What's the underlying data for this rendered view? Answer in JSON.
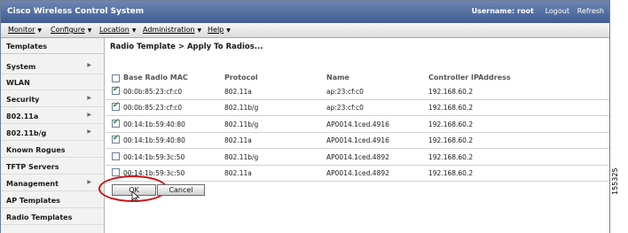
{
  "app": {
    "title": "Cisco Wireless Control System",
    "user_text": "Username: root",
    "logout": "Logout",
    "refresh": "Refresh"
  },
  "menu": [
    {
      "label": "Monitor"
    },
    {
      "label": "Configure"
    },
    {
      "label": "Location"
    },
    {
      "label": "Administration"
    },
    {
      "label": "Help"
    }
  ],
  "sidebar": {
    "header": "Templates",
    "items": [
      {
        "label": "System",
        "arrow": "▶"
      },
      {
        "label": "WLAN",
        "arrow": ""
      },
      {
        "label": "Security",
        "arrow": "▶"
      },
      {
        "label": "802.11a",
        "arrow": "▶"
      },
      {
        "label": "802.11b/g",
        "arrow": "▶"
      },
      {
        "label": "Known Rogues",
        "arrow": ""
      },
      {
        "label": "TFTP Servers",
        "arrow": ""
      },
      {
        "label": "Management",
        "arrow": "▶"
      },
      {
        "label": "AP Templates",
        "arrow": ""
      },
      {
        "label": "Radio Templates",
        "arrow": ""
      }
    ]
  },
  "page": {
    "title": "Radio Template > Apply To Radios..."
  },
  "table": {
    "columns": [
      "Base Radio MAC",
      "Protocol",
      "Name",
      "Controller IPAddress"
    ],
    "rows": [
      {
        "mac": "00:0b:85:23:cf:c0",
        "protocol": "802.11a",
        "name": "ap:23:cf:c0",
        "ip": "192.168.60.2",
        "checked": true
      },
      {
        "mac": "00:0b:85:23:cf:c0",
        "protocol": "802.11b/g",
        "name": "ap:23:cf:c0",
        "ip": "192.168.60.2",
        "checked": true
      },
      {
        "mac": "00:14:1b:59:40:80",
        "protocol": "802.11b/g",
        "name": "AP0014.1ced.4916",
        "ip": "192.168.60.2",
        "checked": true
      },
      {
        "mac": "00:14:1b:59:40:80",
        "protocol": "802.11a",
        "name": "AP0014.1ced.4916",
        "ip": "192.168.60.2",
        "checked": true
      },
      {
        "mac": "00:14:1b:59:3c:50",
        "protocol": "802.11b/g",
        "name": "AP0014.1ced.4892",
        "ip": "192.168.60.2",
        "checked": false
      },
      {
        "mac": "00:14:1b:59:3c:50",
        "protocol": "802.11a",
        "name": "AP0014.1ced.4892",
        "ip": "192.168.60.2",
        "checked": false
      }
    ]
  },
  "buttons": {
    "ok": "OK",
    "cancel": "Cancel"
  },
  "figure_number": "155325",
  "colors": {
    "titlebar": "#4a659c",
    "highlight": "#cc1111",
    "check": "#2e8b2e"
  }
}
